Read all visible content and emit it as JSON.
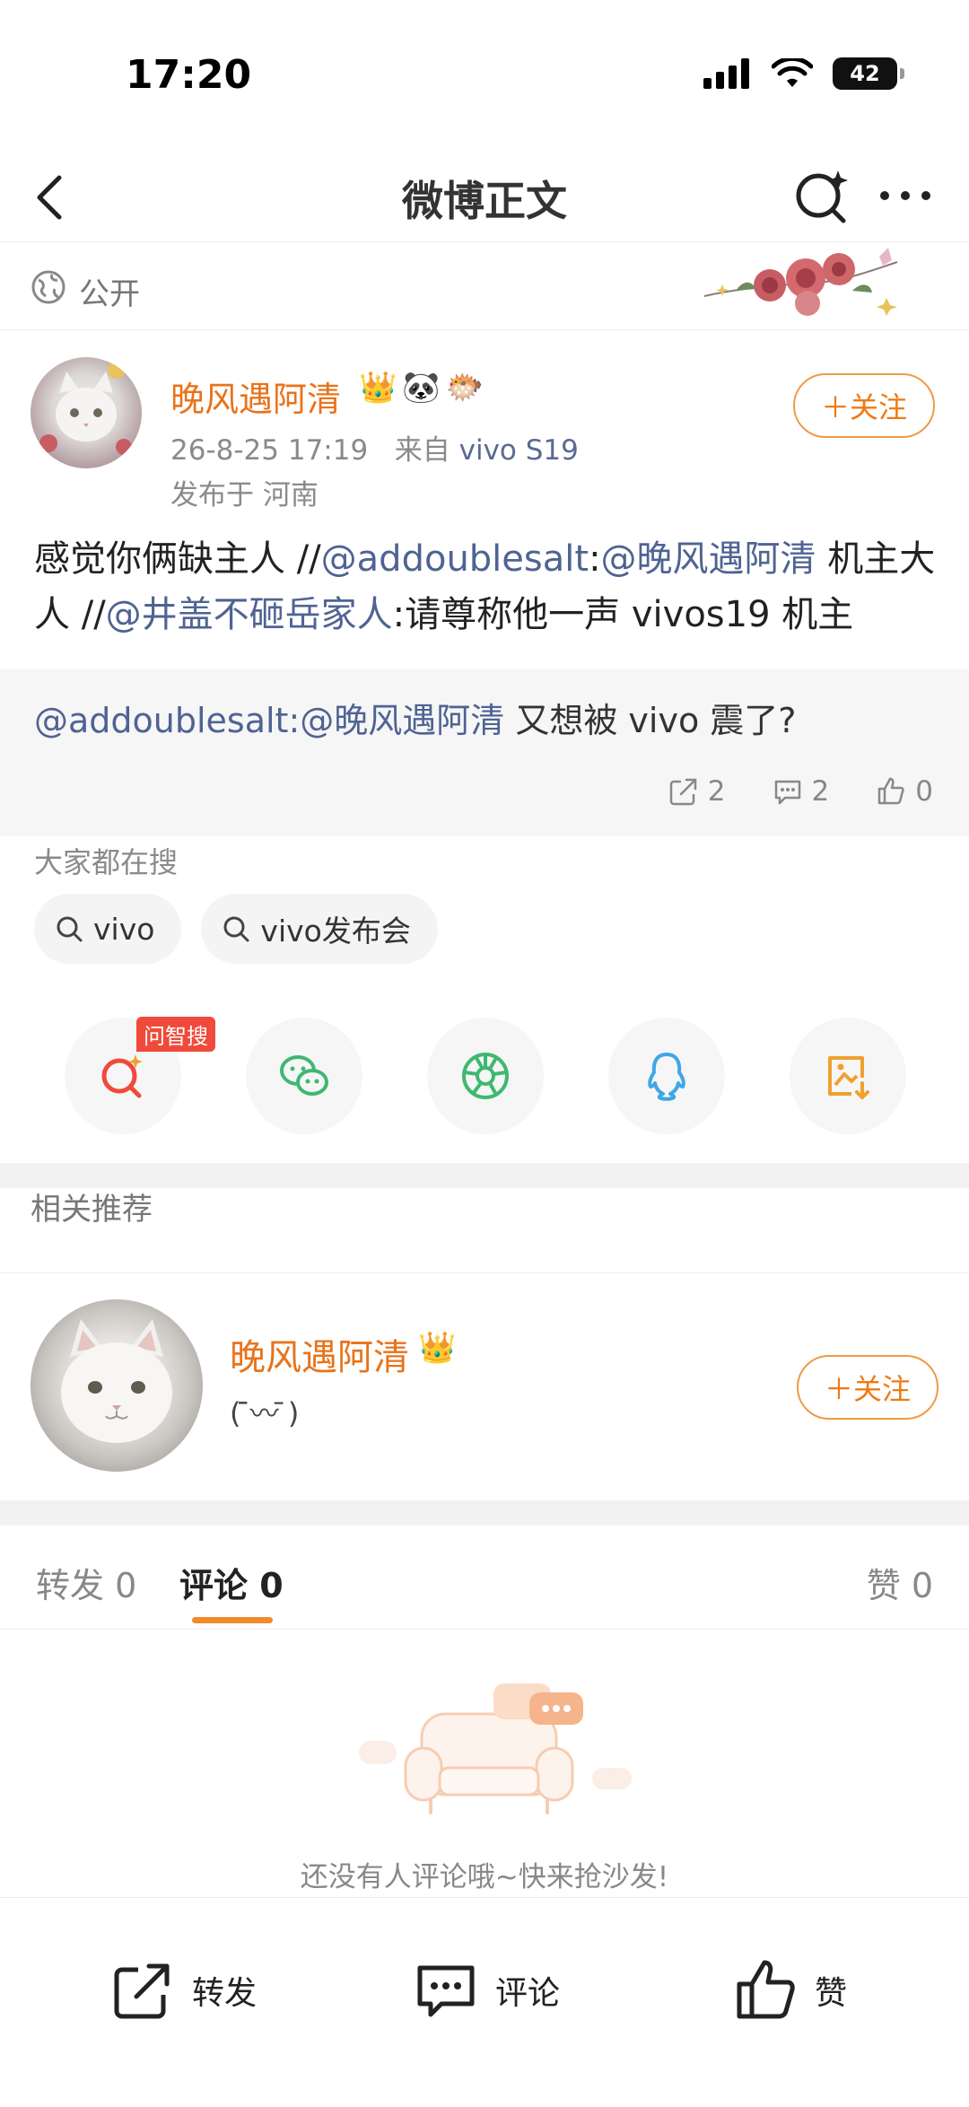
{
  "status_bar": {
    "time": "17:20",
    "battery": "42"
  },
  "nav": {
    "title": "微博正文"
  },
  "visibility": {
    "label": "公开"
  },
  "post": {
    "author": "晚风遇阿清",
    "badges": [
      "👑",
      "🐼",
      "🐡"
    ],
    "timestamp": "26-8-25 17:19",
    "source_prefix": "来自",
    "source_device": "vivo S19",
    "location": "发布于 河南",
    "follow_label": "＋关注",
    "text_parts": {
      "p1": "感觉你俩缺主人 //",
      "m1": "@addoublesalt",
      "p2": ":",
      "m2": "@晚风遇阿清",
      "p3": " 机主大人 //",
      "m3": "@井盖不砸岳家人",
      "p4": ":请尊称他一声 vivos19 机主"
    }
  },
  "repost": {
    "mention": "@addoublesalt:@晚风遇阿清",
    "text": " 又想被 vivo 震了?",
    "reposts": "2",
    "comments": "2",
    "likes": "0"
  },
  "hot_search": {
    "label": "大家都在搜",
    "chips": [
      "vivo",
      "vivo发布会"
    ]
  },
  "share": {
    "ai_tag": "问智搜"
  },
  "related": {
    "title": "相关推荐",
    "name": "晚风遇阿清",
    "badge": "👑",
    "bio": "(  ̄̄〰̄̄  )",
    "follow_label": "＋关注"
  },
  "tabs": {
    "repost_label": "转发",
    "repost_count": "0",
    "comment_label": "评论",
    "comment_count": "0",
    "like_label": "赞",
    "like_count": "0"
  },
  "empty_state": {
    "text": "还没有人评论哦~快来抢沙发!"
  },
  "bottom_bar": {
    "repost": "转发",
    "comment": "评论",
    "like": "赞"
  },
  "colors": {
    "accent": "#ee7b14",
    "mention": "#4f6393",
    "name": "#e8731b"
  }
}
